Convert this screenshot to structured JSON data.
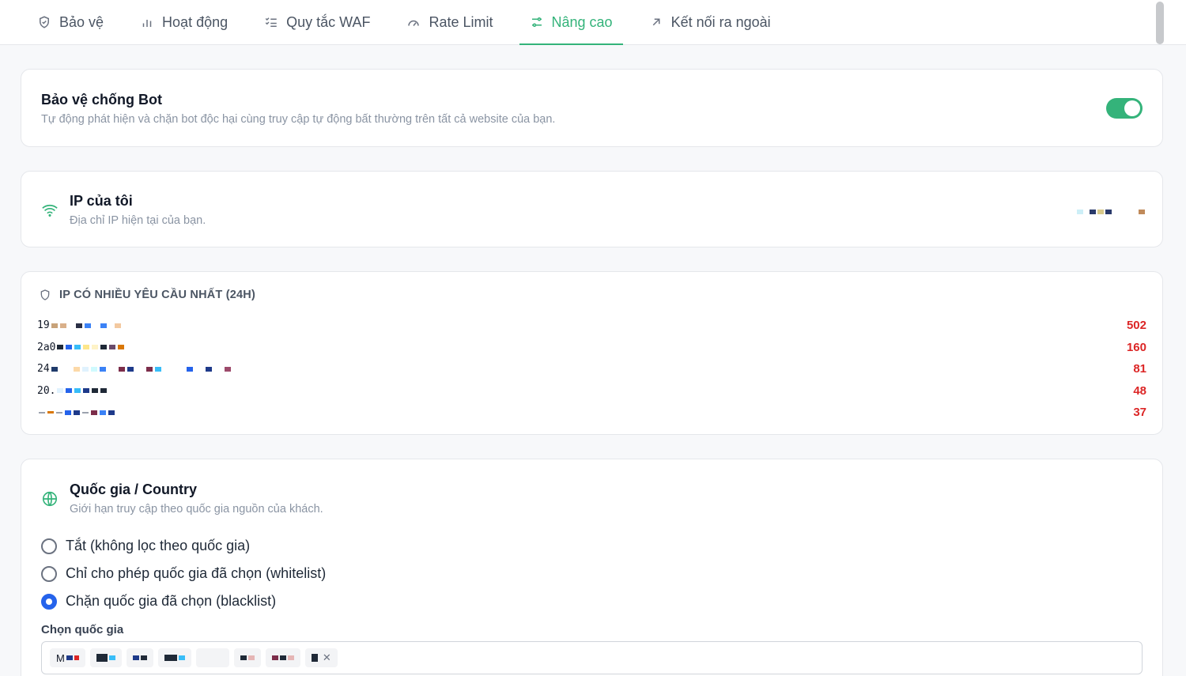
{
  "tabs": [
    {
      "label": "Bảo vệ",
      "icon": "shield-icon",
      "active": false
    },
    {
      "label": "Hoạt động",
      "icon": "bar-chart-icon",
      "active": false
    },
    {
      "label": "Quy tắc WAF",
      "icon": "list-check-icon",
      "active": false
    },
    {
      "label": "Rate Limit",
      "icon": "gauge-icon",
      "active": false
    },
    {
      "label": "Nâng cao",
      "icon": "sliders-icon",
      "active": true
    },
    {
      "label": "Kết nối ra ngoài",
      "icon": "arrow-up-right-icon",
      "active": false
    }
  ],
  "bot": {
    "title": "Bảo vệ chống Bot",
    "subtitle": "Tự động phát hiện và chặn bot độc hại cùng truy cập tự động bất thường trên tất cả website của bạn.",
    "enabled": true
  },
  "my_ip": {
    "title": "IP của tôi",
    "subtitle": "Địa chỉ IP hiện tại của bạn."
  },
  "top_ips": {
    "title": "IP CÓ NHIỀU YÊU CẦU NHẤT (24H)",
    "rows": [
      {
        "prefix": "19",
        "count": "502"
      },
      {
        "prefix": "2a0",
        "count": "160"
      },
      {
        "prefix": "24",
        "count": "81"
      },
      {
        "prefix": "20.",
        "count": "48"
      },
      {
        "prefix": "",
        "count": "37"
      }
    ]
  },
  "country": {
    "title": "Quốc gia / Country",
    "subtitle": "Giới hạn truy cập theo quốc gia nguồn của khách.",
    "options": [
      {
        "label": "Tắt (không lọc theo quốc gia)",
        "checked": false
      },
      {
        "label": "Chỉ cho phép quốc gia đã chọn (whitelist)",
        "checked": false
      },
      {
        "label": "Chặn quốc gia đã chọn (blacklist)",
        "checked": true
      }
    ],
    "select_label": "Chọn quốc gia",
    "chips": [
      "M",
      "",
      "",
      "",
      "",
      "",
      "",
      ""
    ]
  },
  "colors": {
    "accent": "#34b37a",
    "danger": "#dc2626",
    "radio": "#2563eb"
  }
}
